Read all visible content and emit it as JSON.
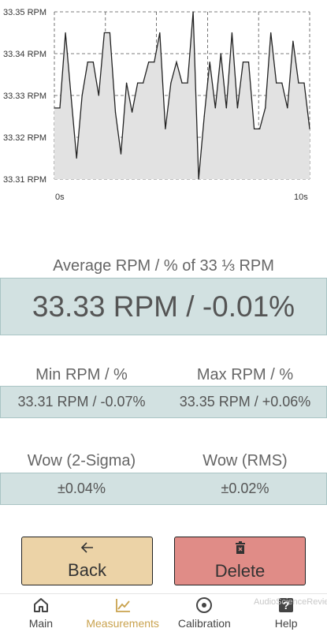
{
  "chart_data": {
    "type": "area",
    "x_start_label": "0s",
    "x_end_label": "10s",
    "xlim": [
      0,
      10
    ],
    "ylim": [
      33.31,
      33.35
    ],
    "y_ticks": [
      "33.35 RPM",
      "33.34 RPM",
      "33.33 RPM",
      "33.32 RPM",
      "33.31 RPM"
    ],
    "grid": true,
    "fill_color": "#e2e2e2",
    "line_color": "#222222",
    "y": [
      33.327,
      33.327,
      33.345,
      33.33,
      33.315,
      33.33,
      33.338,
      33.338,
      33.33,
      33.345,
      33.345,
      33.326,
      33.316,
      33.333,
      33.326,
      33.333,
      33.333,
      33.338,
      33.338,
      33.345,
      33.322,
      33.333,
      33.338,
      33.333,
      33.333,
      33.35,
      33.31,
      33.325,
      33.338,
      33.327,
      33.34,
      33.327,
      33.345,
      33.327,
      33.338,
      33.338,
      33.322,
      33.322,
      33.327,
      33.345,
      33.333,
      33.333,
      33.327,
      33.343,
      33.333,
      33.333,
      33.322
    ]
  },
  "average": {
    "label": "Average RPM / % of 33 ⅓ RPM",
    "value": "33.33 RPM / -0.01%"
  },
  "min": {
    "label": "Min RPM / %",
    "value": "33.31 RPM / -0.07%"
  },
  "max": {
    "label": "Max RPM / %",
    "value": "33.35 RPM / +0.06%"
  },
  "wow2sigma": {
    "label": "Wow (2-Sigma)",
    "value": "±0.04%"
  },
  "wowrms": {
    "label": "Wow (RMS)",
    "value": "±0.02%"
  },
  "buttons": {
    "back": {
      "label": "Back",
      "icon": "arrow-left-icon",
      "color": "#ecd3a7"
    },
    "delete": {
      "label": "Delete",
      "icon": "trash-icon",
      "color": "#e08c87"
    }
  },
  "nav": {
    "items": [
      {
        "label": "Main",
        "icon": "home-icon",
        "active": false
      },
      {
        "label": "Measurements",
        "icon": "chart-icon",
        "active": true
      },
      {
        "label": "Calibration",
        "icon": "target-icon",
        "active": false
      },
      {
        "label": "Help",
        "icon": "help-icon",
        "active": false
      }
    ],
    "active_color": "#c9a24e"
  },
  "watermark": "AudioScienceReview"
}
